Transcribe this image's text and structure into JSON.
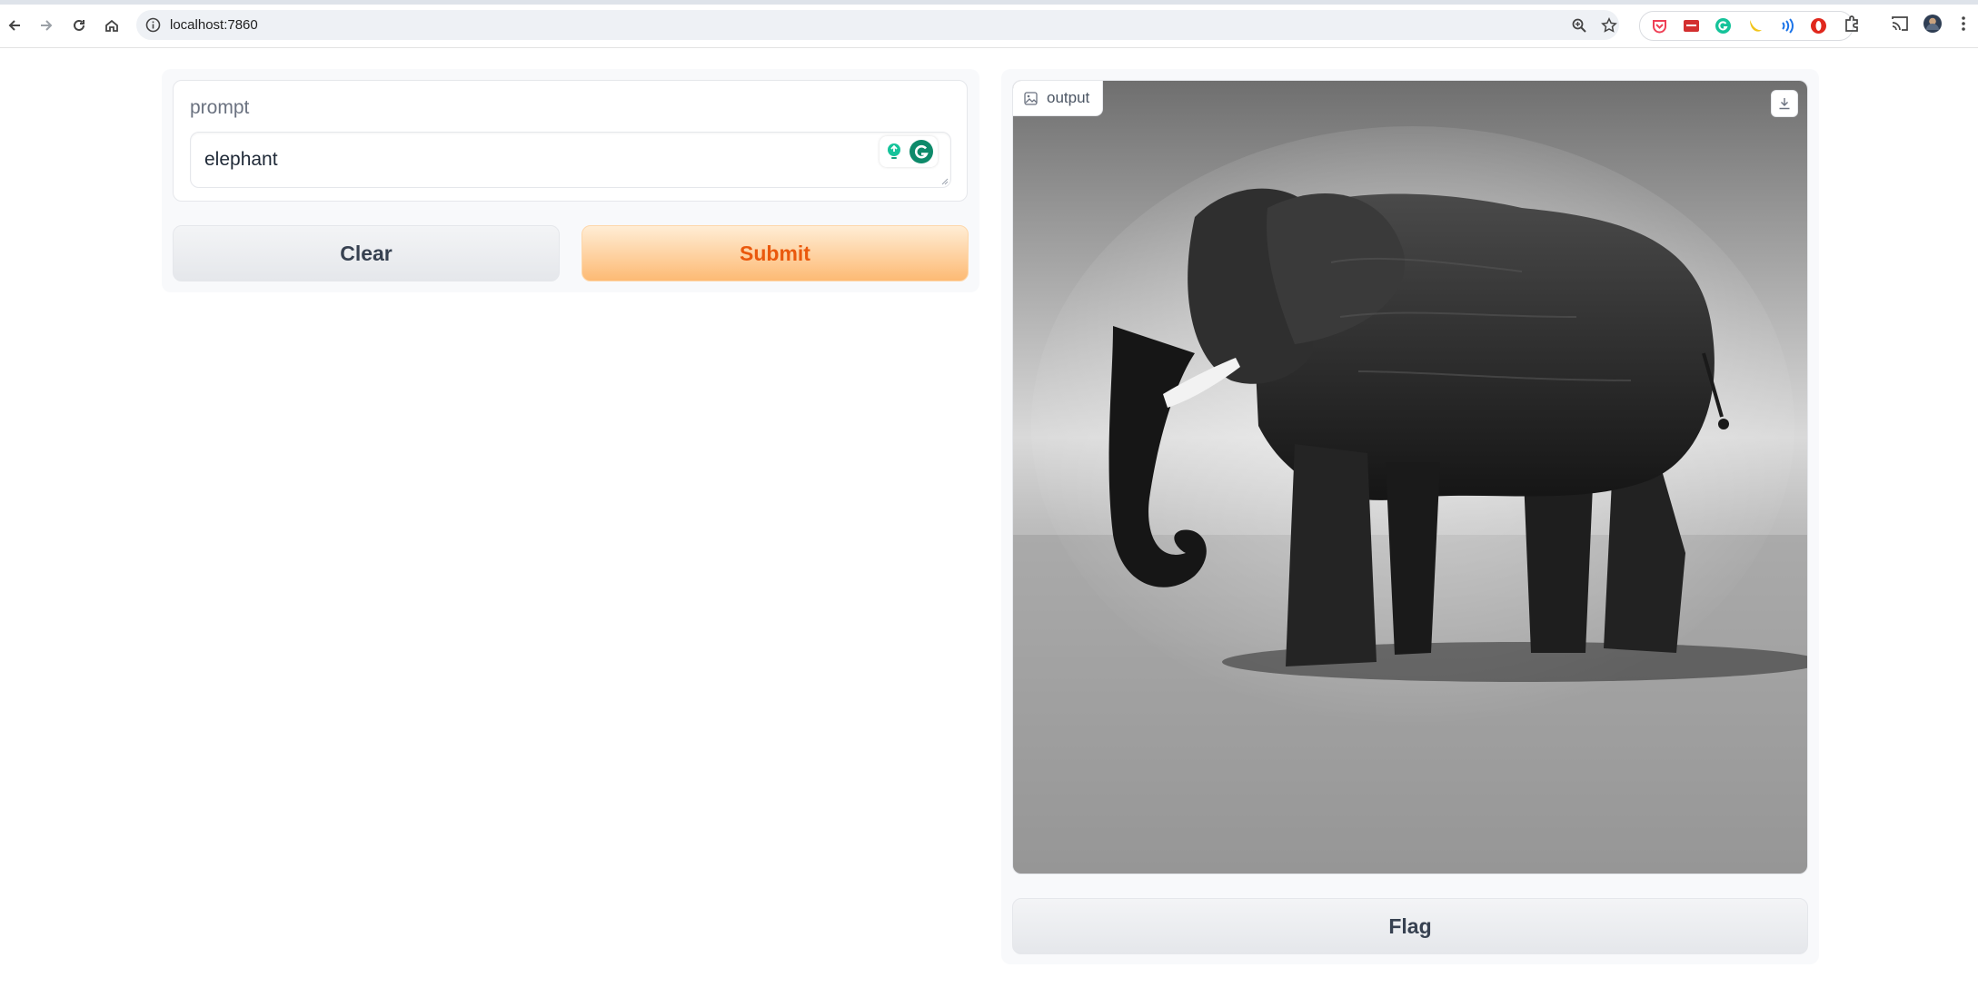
{
  "browser": {
    "url": "localhost:7860",
    "icons": {
      "back": "back-arrow-icon",
      "forward": "forward-arrow-icon",
      "reload": "reload-icon",
      "home": "home-icon",
      "site_info": "site-info-icon",
      "zoom": "zoom-icon",
      "bookmark": "star-icon",
      "extensions": [
        "pocket-icon",
        "red-extension-icon",
        "grammarly-icon",
        "banana-icon",
        "wave-icon",
        "opera-icon",
        "puzzle-icon"
      ],
      "cast": "cast-icon",
      "profile": "avatar",
      "menu": "kebab-menu-icon"
    }
  },
  "form": {
    "prompt_label": "prompt",
    "prompt_value": "elephant",
    "clear_label": "Clear",
    "submit_label": "Submit"
  },
  "output": {
    "label": "output",
    "image_subject": "black-and-white elephant",
    "flag_label": "Flag"
  },
  "colors": {
    "submit_text": "#ea580c",
    "submit_bg": "#fdba74",
    "panel_bg": "#f8f9fb"
  }
}
